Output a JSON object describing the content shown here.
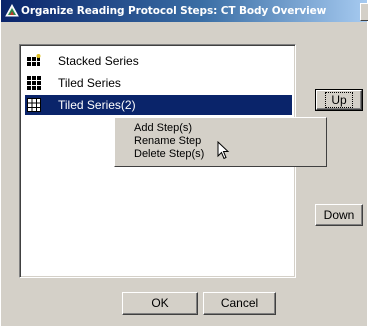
{
  "window": {
    "title": "Organize Reading Protocol Steps: CT Body Overview",
    "title_icon": "app-triangle-icon"
  },
  "list": {
    "items": [
      {
        "label": "Stacked Series",
        "icon": "stacked-series-icon",
        "selected": false
      },
      {
        "label": "Tiled Series",
        "icon": "tiled-series-icon",
        "selected": false
      },
      {
        "label": "Tiled Series(2)",
        "icon": "tiled-grid-icon",
        "selected": true
      }
    ]
  },
  "context_menu": {
    "items": [
      "Add Step(s)",
      "Rename Step",
      "Delete Step(s)"
    ]
  },
  "buttons": {
    "up": "Up",
    "down": "Down",
    "ok": "OK",
    "cancel": "Cancel"
  },
  "colors": {
    "title_start": "#0a246a",
    "title_end": "#a6caf0",
    "face": "#d4d0c8",
    "selection": "#0a246a"
  }
}
